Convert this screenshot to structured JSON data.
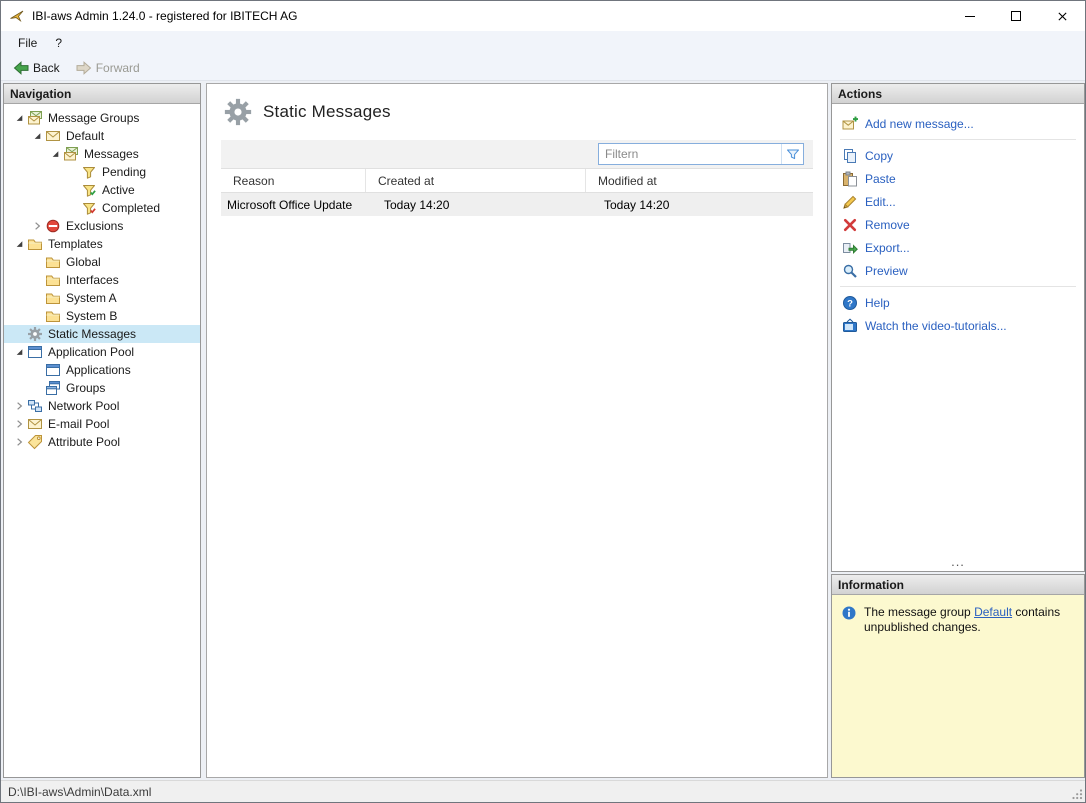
{
  "colors": {
    "link": "#2a60c0",
    "tree_selection": "#cbe8f6",
    "info_background": "#fcf9cf",
    "panel_header_background": "#d8d8d8",
    "chrome_background": "#f1f4fa"
  },
  "window": {
    "title": "IBI-aws Admin 1.24.0 - registered for IBITECH AG"
  },
  "menu": {
    "file": "File",
    "help": "?"
  },
  "toolbar": {
    "back": "Back",
    "forward": "Forward"
  },
  "navigation": {
    "header": "Navigation",
    "tree": [
      {
        "label": "Message Groups"
      },
      {
        "label": "Default"
      },
      {
        "label": "Messages"
      },
      {
        "label": "Pending"
      },
      {
        "label": "Active"
      },
      {
        "label": "Completed"
      },
      {
        "label": "Exclusions"
      },
      {
        "label": "Templates"
      },
      {
        "label": "Global"
      },
      {
        "label": "Interfaces"
      },
      {
        "label": "System A"
      },
      {
        "label": "System B"
      },
      {
        "label": "Static Messages"
      },
      {
        "label": "Application Pool"
      },
      {
        "label": "Applications"
      },
      {
        "label": "Groups"
      },
      {
        "label": "Network Pool"
      },
      {
        "label": "E-mail Pool"
      },
      {
        "label": "Attribute Pool"
      }
    ]
  },
  "main": {
    "title": "Static Messages",
    "filter_placeholder": "Filtern",
    "table": {
      "columns": [
        "Reason",
        "Created at",
        "Modified at"
      ],
      "rows": [
        {
          "reason": "Microsoft Office Update",
          "created": "Today 14:20",
          "modified": "Today 14:20"
        }
      ]
    }
  },
  "actions": {
    "header": "Actions",
    "items": [
      {
        "label": "Add new message..."
      },
      {
        "label": "Copy"
      },
      {
        "label": "Paste"
      },
      {
        "label": "Edit..."
      },
      {
        "label": "Remove"
      },
      {
        "label": "Export..."
      },
      {
        "label": "Preview"
      },
      {
        "label": "Help"
      },
      {
        "label": "Watch the video-tutorials..."
      }
    ],
    "overflow": "..."
  },
  "information": {
    "header": "Information",
    "text_before": "The message group ",
    "link": "Default",
    "text_after": " contains unpublished changes."
  },
  "statusbar": {
    "path": "D:\\IBI-aws\\Admin\\Data.xml"
  }
}
